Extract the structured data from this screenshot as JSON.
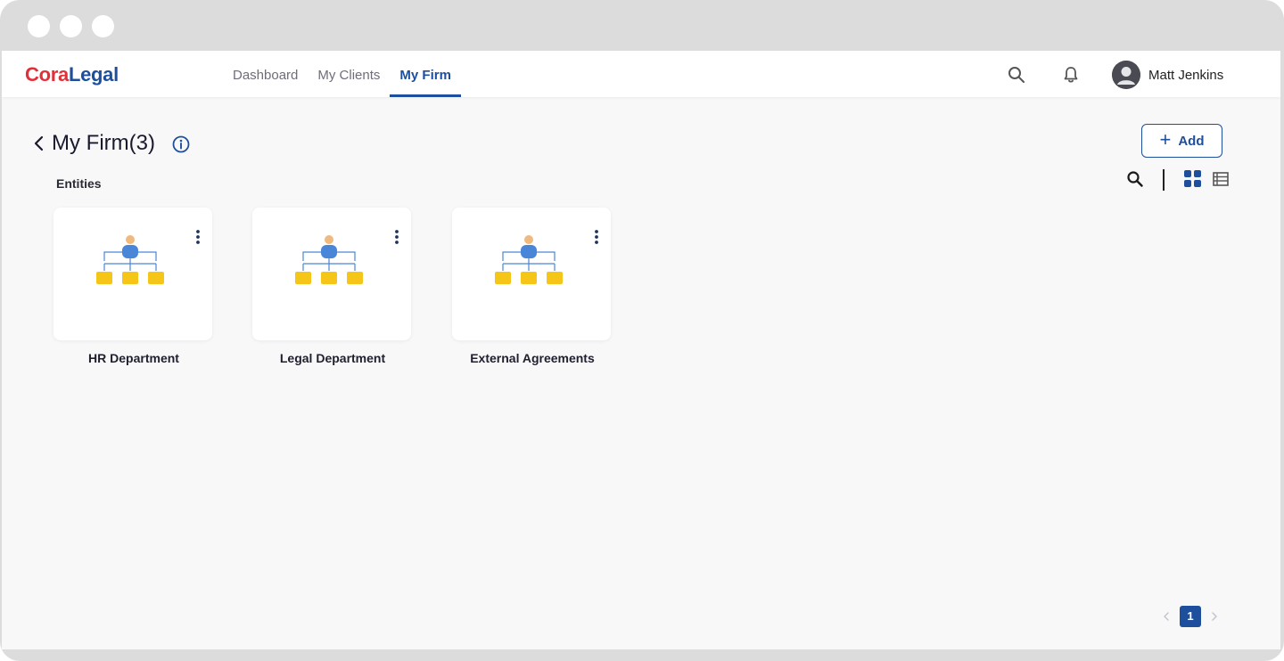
{
  "window": {
    "controls": [
      "window-dot",
      "window-dot",
      "window-dot"
    ]
  },
  "header": {
    "logo_part1": "Cora",
    "logo_part2": "Legal",
    "nav": [
      {
        "label": "Dashboard",
        "active": false
      },
      {
        "label": "My Clients",
        "active": false
      },
      {
        "label": "My Firm",
        "active": true
      }
    ],
    "icons": [
      "search-icon",
      "bell-icon",
      "avatar-icon"
    ],
    "user_name": "Matt Jenkins"
  },
  "page": {
    "title": "My Firm(3)",
    "section_label": "Entities",
    "add_label": "Add",
    "toolbar_icons": [
      "search-icon",
      "grid-view-icon",
      "list-view-icon"
    ]
  },
  "entities": [
    {
      "name": "HR Department"
    },
    {
      "name": "Legal Department"
    },
    {
      "name": "External Agreements"
    }
  ],
  "pagination": {
    "current_page": "1"
  },
  "colors": {
    "brand_red": "#e0303a",
    "brand_blue": "#1d4f9c",
    "node_yellow": "#f5c518",
    "person_blue": "#4a86d8",
    "person_skin": "#f0b97d"
  }
}
